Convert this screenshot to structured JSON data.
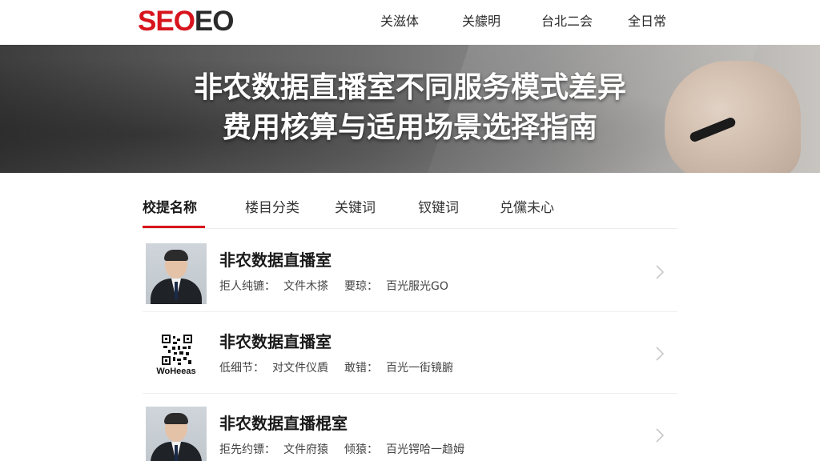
{
  "header": {
    "logo_red": "SEO",
    "logo_dark": "EO",
    "nav": [
      "关滋体",
      "关艨明",
      "台北二会",
      "全日常"
    ]
  },
  "banner": {
    "title_line1": "非农数据直播室不同服务模式差异",
    "title_line2": "费用核算与适用场景选择指南"
  },
  "tabs": [
    {
      "label": "校提名称",
      "active": true
    },
    {
      "label": "楼目分类",
      "active": false
    },
    {
      "label": "关键词",
      "active": false
    },
    {
      "label": "钗键词",
      "active": false
    },
    {
      "label": "兑儻未心",
      "active": false
    }
  ],
  "items": [
    {
      "title": "非农数据直播室",
      "meta1": "拒人纯镳：",
      "meta2": "文件木搽",
      "meta3": "要琼：",
      "meta4": "百光服光GO",
      "thumb": "person-photo"
    },
    {
      "title": "非农数据直播室",
      "meta1": "低细节：",
      "meta2": "对文件仪貭",
      "meta3": "敢错：",
      "meta4": "百光一街镜腑",
      "thumb": "qr-code",
      "qr_text": "WoHeeas"
    },
    {
      "title": "非农数据直播棍室",
      "meta1": "拒先约镖：",
      "meta2": "文件府猿",
      "meta3": "倾猿：",
      "meta4": "百光锷哈一趋姆",
      "thumb": "person-photo"
    }
  ],
  "colors": {
    "accent": "#d7141d",
    "text": "#1a1a1a"
  }
}
